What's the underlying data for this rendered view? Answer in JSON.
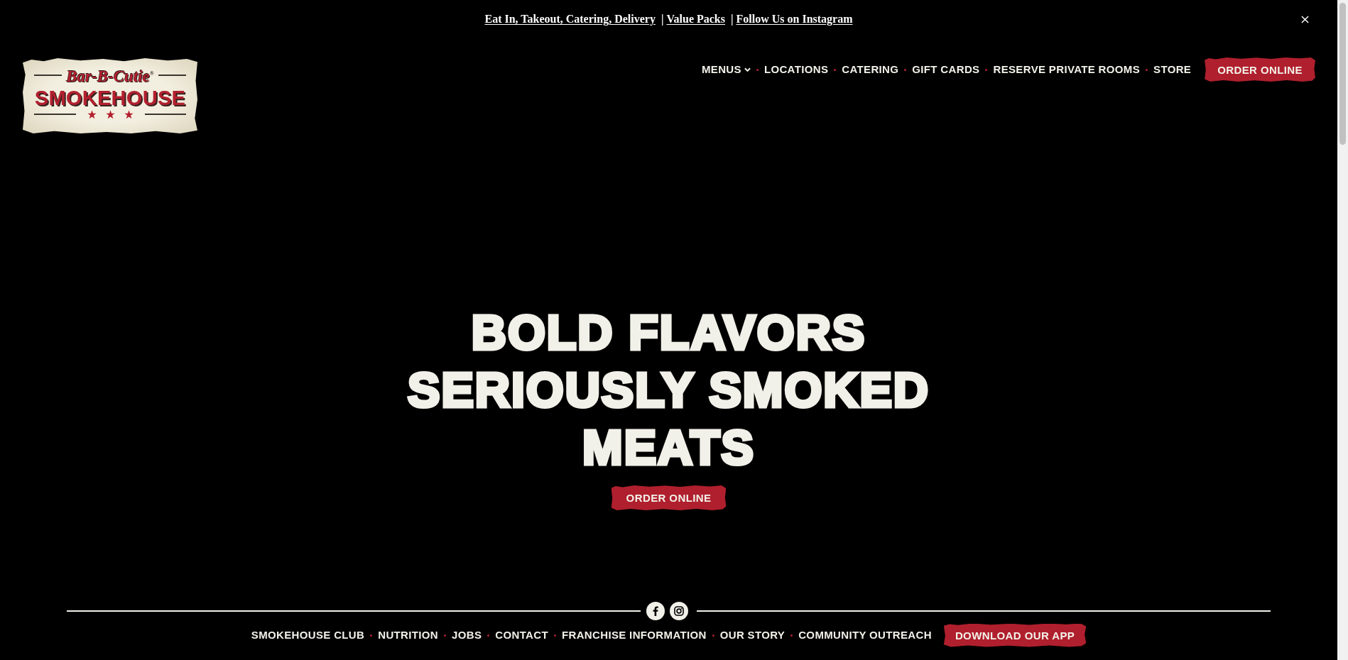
{
  "announcement": {
    "items": [
      {
        "kind": "link",
        "text": "Eat In, Takeout, Catering, Delivery"
      },
      {
        "kind": "separator",
        "text": "|"
      },
      {
        "kind": "link",
        "text": "Value Packs"
      },
      {
        "kind": "separator",
        "text": "|"
      },
      {
        "kind": "link",
        "text": "Follow Us on Instagram"
      }
    ]
  },
  "logo": {
    "script": "Bar-B-Cutie$^{®}$",
    "title": "SMOKEHOUSE"
  },
  "nav": {
    "items": [
      {
        "kind": "dropdown",
        "label": "MENUS"
      },
      {
        "kind": "link",
        "label": "LOCATIONS"
      },
      {
        "kind": "link",
        "label": "CATERING"
      },
      {
        "kind": "link",
        "label": "GIFT CARDS"
      },
      {
        "kind": "link",
        "label": "RESERVE PRIVATE ROOMS"
      },
      {
        "kind": "link",
        "label": "STORE"
      },
      {
        "kind": "button",
        "label": "ORDER ONLINE"
      }
    ]
  },
  "hero": {
    "heading": "BOLD FLAVORS SERIOUSLY SMOKED MEATS",
    "button": "ORDER ONLINE"
  },
  "footer": {
    "links": [
      {
        "kind": "link",
        "label": "SMOKEHOUSE CLUB"
      },
      {
        "kind": "link",
        "label": "NUTRITION"
      },
      {
        "kind": "link",
        "label": "JOBS"
      },
      {
        "kind": "link",
        "label": "CONTACT"
      },
      {
        "kind": "link",
        "label": "FRANCHISE INFORMATION"
      },
      {
        "kind": "link",
        "label": "OUR STORY"
      },
      {
        "kind": "link",
        "label": "COMMUNITY OUTREACH"
      },
      {
        "kind": "button",
        "label": "DOWNLOAD OUR APP"
      }
    ]
  }
}
